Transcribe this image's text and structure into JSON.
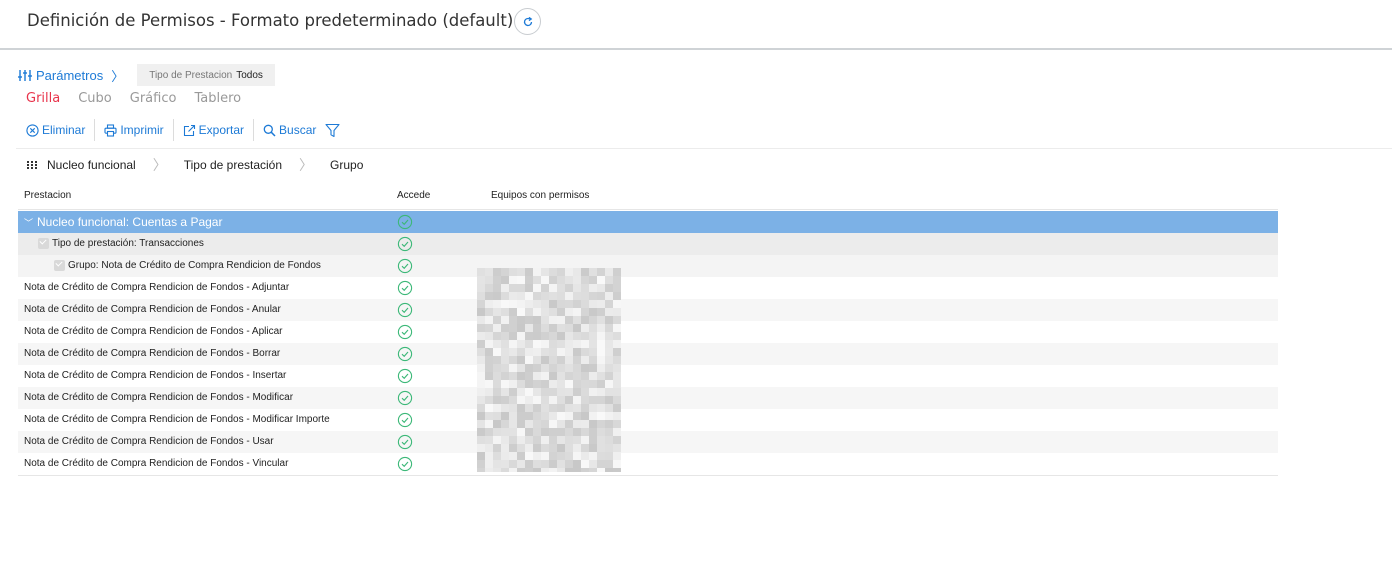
{
  "header": {
    "title": "Definición de Permisos - Formato predeterminado (default)",
    "refresh_icon": "refresh-icon"
  },
  "params": {
    "label": "Parámetros",
    "icon": "sliders-icon",
    "filter": {
      "label": "Tipo de Prestacion",
      "value": "Todos"
    }
  },
  "views": {
    "tabs": [
      {
        "label": "Grilla",
        "active": true
      },
      {
        "label": "Cubo",
        "active": false
      },
      {
        "label": "Gráfico",
        "active": false
      },
      {
        "label": "Tablero",
        "active": false
      }
    ]
  },
  "toolbar": {
    "delete_label": "Eliminar",
    "print_label": "Imprimir",
    "export_label": "Exportar",
    "search_label": "Buscar"
  },
  "grouping": {
    "levels": [
      "Nucleo funcional",
      "Tipo de prestación",
      "Grupo"
    ]
  },
  "grid": {
    "columns": [
      "Prestacion",
      "Accede",
      "Equipos con permisos"
    ],
    "group_rows": [
      {
        "label": "Nucleo funcional: Cuentas a Pagar",
        "accede": true
      },
      {
        "label": "Tipo de prestación: Transacciones",
        "accede": true
      },
      {
        "label": "Grupo: Nota de Crédito de Compra Rendicion de Fondos",
        "accede": true
      }
    ],
    "rows": [
      {
        "prestacion": "Nota de Crédito de Compra Rendicion de Fondos - Adjuntar",
        "accede": true
      },
      {
        "prestacion": "Nota de Crédito de Compra Rendicion de Fondos - Anular",
        "accede": true
      },
      {
        "prestacion": "Nota de Crédito de Compra Rendicion de Fondos - Aplicar",
        "accede": true
      },
      {
        "prestacion": "Nota de Crédito de Compra Rendicion de Fondos - Borrar",
        "accede": true
      },
      {
        "prestacion": "Nota de Crédito de Compra Rendicion de Fondos - Insertar",
        "accede": true
      },
      {
        "prestacion": "Nota de Crédito de Compra Rendicion de Fondos - Modificar",
        "accede": true
      },
      {
        "prestacion": "Nota de Crédito de Compra Rendicion de Fondos - Modificar Importe",
        "accede": true
      },
      {
        "prestacion": "Nota de Crédito de Compra Rendicion de Fondos - Usar",
        "accede": true
      },
      {
        "prestacion": "Nota de Crédito de Compra Rendicion de Fondos - Vincular",
        "accede": true
      }
    ]
  },
  "colors": {
    "accent": "#1d7ad6",
    "active_tab": "#e8344c",
    "group_row": "#7cb1e6",
    "check": "#3cb878"
  }
}
